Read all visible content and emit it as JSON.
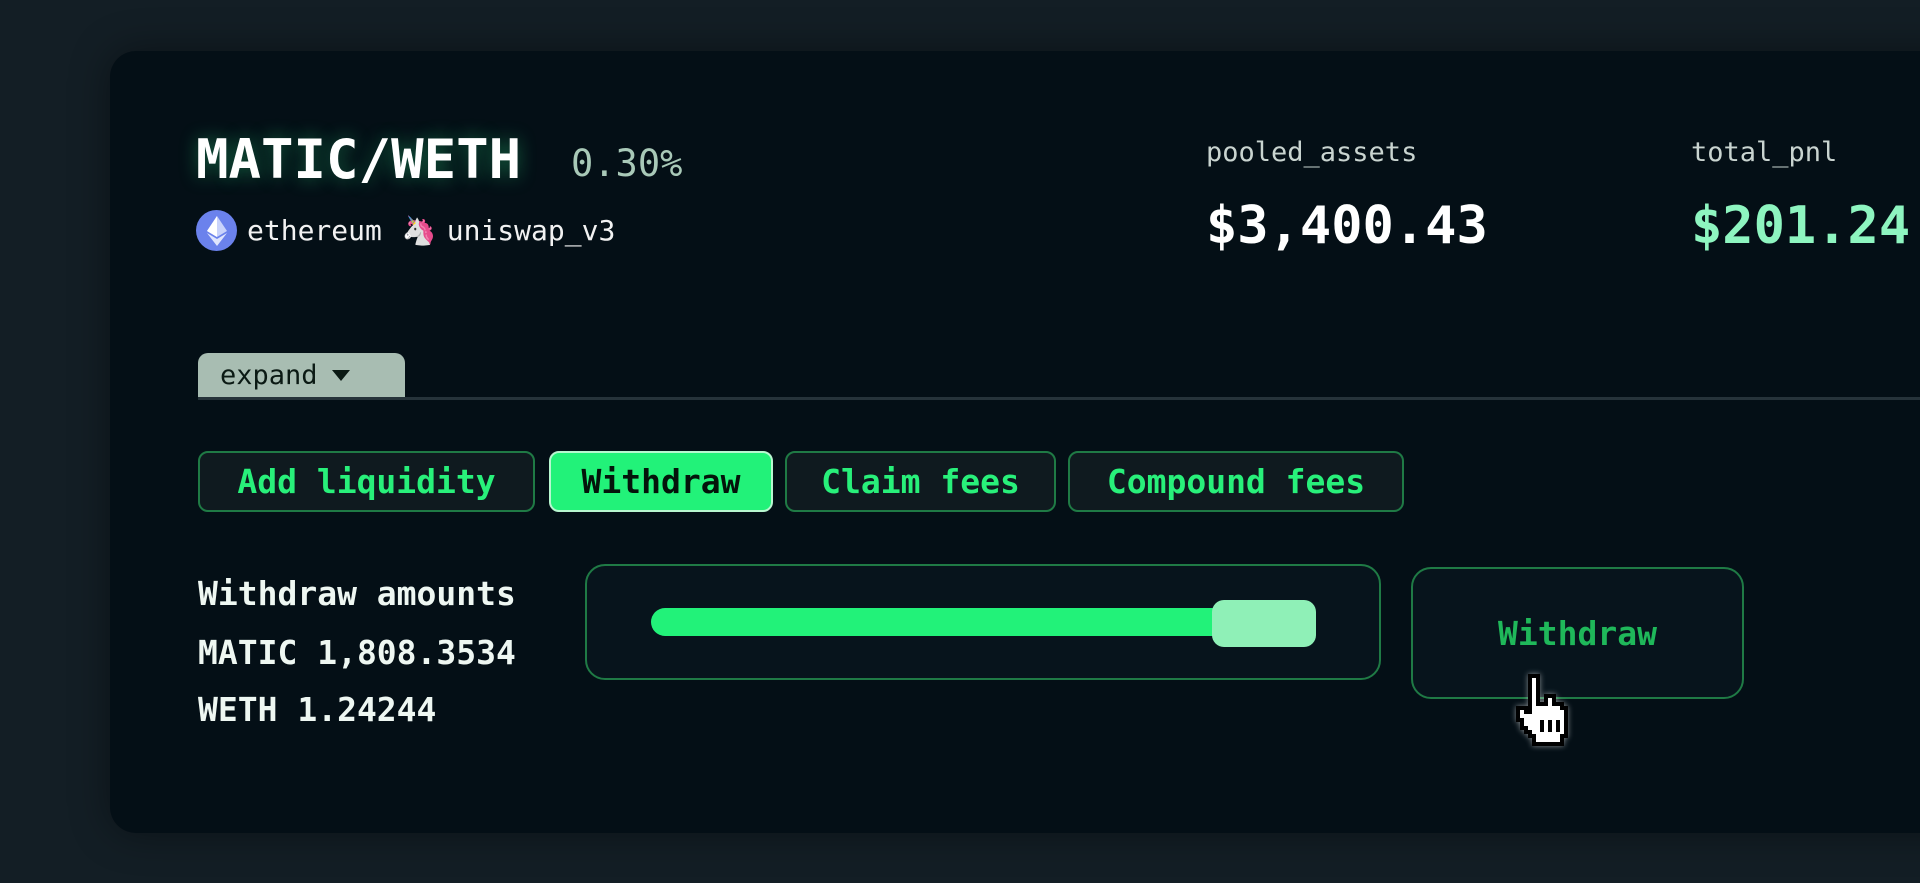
{
  "pool": {
    "pair": "MATIC/WETH",
    "fee_tier": "0.30%",
    "chain": "ethereum",
    "chain_icon": "ethereum-icon",
    "protocol": "uniswap_v3",
    "protocol_icon": "unicorn-icon"
  },
  "stats": [
    {
      "label": "pooled_assets",
      "value": "$3,400.43",
      "color": "#ffffff"
    },
    {
      "label": "total_pnl",
      "value": "$201.24",
      "color": "#8ef5c0"
    }
  ],
  "expand": {
    "label": "expand",
    "icon": "caret-down-icon"
  },
  "actions": [
    {
      "label": "Add liquidity",
      "active": false
    },
    {
      "label": "Withdraw",
      "active": true
    },
    {
      "label": "Claim fees",
      "active": false
    },
    {
      "label": "Compound fees",
      "active": false
    }
  ],
  "withdraw": {
    "heading": "Withdraw amounts",
    "matic": "MATIC 1,808.3534",
    "weth": "WETH 1.24244",
    "slider_percent": 100,
    "button_label": "Withdraw"
  },
  "colors": {
    "accent": "#22f279",
    "background": "#040f16"
  }
}
